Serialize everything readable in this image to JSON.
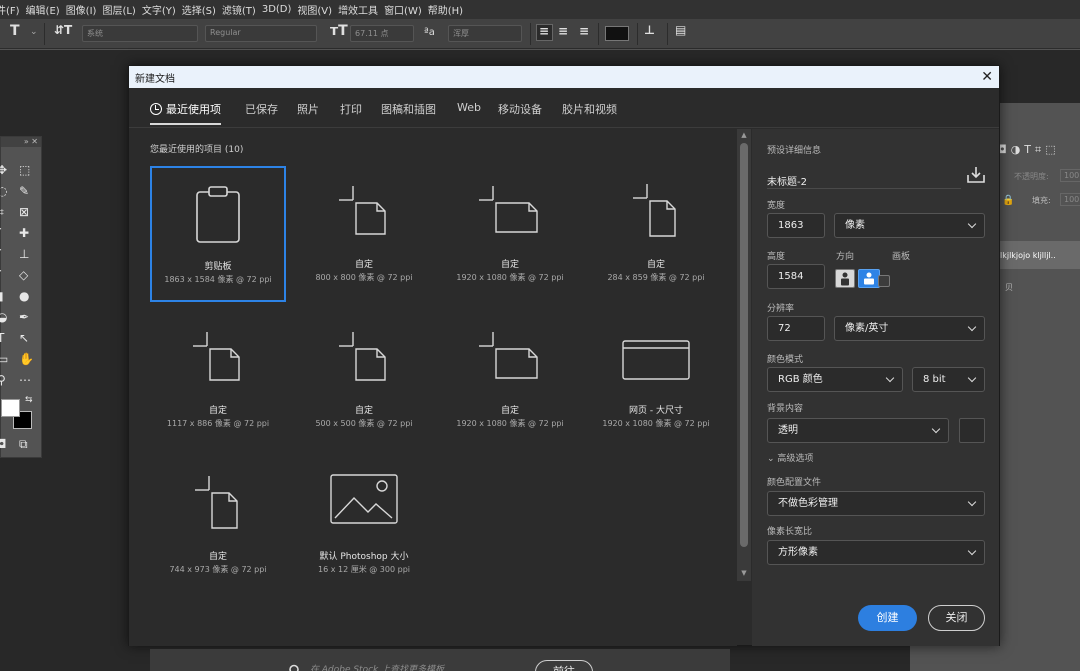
{
  "menu": [
    "件(F)",
    "编辑(E)",
    "图像(I)",
    "图层(L)",
    "文字(Y)",
    "选择(S)",
    "滤镜(T)",
    "3D(D)",
    "视图(V)",
    "增效工具",
    "窗口(W)",
    "帮助(H)"
  ],
  "options_bar": {
    "font_family": "系统",
    "font_style": "Regular",
    "font_size": "67.11 点",
    "antialias": "浑厚"
  },
  "right_panel_bg": {
    "opacity_label": "不透明度:",
    "opacity_value": "100",
    "fill_label": "填充:",
    "fill_value": "100",
    "layer_text": "lkjlkjojo kljlljl..",
    "layer2_text": "贝"
  },
  "dialog": {
    "title": "新建文档",
    "close_glyph": "✕",
    "tabs": [
      "最近使用项",
      "已保存",
      "照片",
      "打印",
      "图稿和插图",
      "Web",
      "移动设备",
      "胶片和视频"
    ],
    "recent_heading": "您最近使用的项目 (10)",
    "items": [
      {
        "name": "剪贴板",
        "meta": "1863 x 1584 像素 @ 72 ppi",
        "icon": "clipboard-icon"
      },
      {
        "name": "自定",
        "meta": "800 x 800 像素 @ 72 ppi",
        "icon": "custom-doc-icon"
      },
      {
        "name": "自定",
        "meta": "1920 x 1080 像素 @ 72 ppi",
        "icon": "custom-landscape-icon"
      },
      {
        "name": "自定",
        "meta": "284 x 859 像素 @ 72 ppi",
        "icon": "custom-portrait-icon"
      },
      {
        "name": "自定",
        "meta": "1117 x 886 像素 @ 72 ppi",
        "icon": "custom-doc-icon"
      },
      {
        "name": "自定",
        "meta": "500 x 500 像素 @ 72 ppi",
        "icon": "custom-doc-icon"
      },
      {
        "name": "自定",
        "meta": "1920 x 1080 像素 @ 72 ppi",
        "icon": "custom-landscape-icon"
      },
      {
        "name": "网页 - 大尺寸",
        "meta": "1920 x 1080 像素 @ 72 ppi",
        "icon": "web-page-icon"
      },
      {
        "name": "自定",
        "meta": "744 x 973 像素 @ 72 ppi",
        "icon": "custom-portrait-icon"
      },
      {
        "name": "默认 Photoshop 大小",
        "meta": "16 x 12 厘米 @ 300 ppi",
        "icon": "image-icon"
      }
    ],
    "search_placeholder": "在 Adobe Stock 上查找更多模板",
    "go_label": "前往",
    "preset": {
      "heading": "预设详细信息",
      "name": "未标题-2",
      "width_label": "宽度",
      "width": "1863",
      "width_unit": "像素",
      "height_label": "高度",
      "height": "1584",
      "orientation_label": "方向",
      "artboard_label": "画板",
      "resolution_label": "分辨率",
      "resolution": "72",
      "resolution_unit": "像素/英寸",
      "color_mode_label": "颜色模式",
      "color_mode": "RGB 颜色",
      "bit_depth": "8 bit",
      "background_label": "背景内容",
      "background": "透明",
      "advanced_label": "高级选项",
      "color_profile_label": "颜色配置文件",
      "color_profile": "不做色彩管理",
      "pixel_aspect_label": "像素长宽比",
      "pixel_aspect": "方形像素"
    },
    "create_label": "创建",
    "close_label": "关闭"
  },
  "colors": {
    "accent": "#2d83e6",
    "dialog_bg": "#2b2b2b",
    "titlebar": "#eaf2fb"
  }
}
